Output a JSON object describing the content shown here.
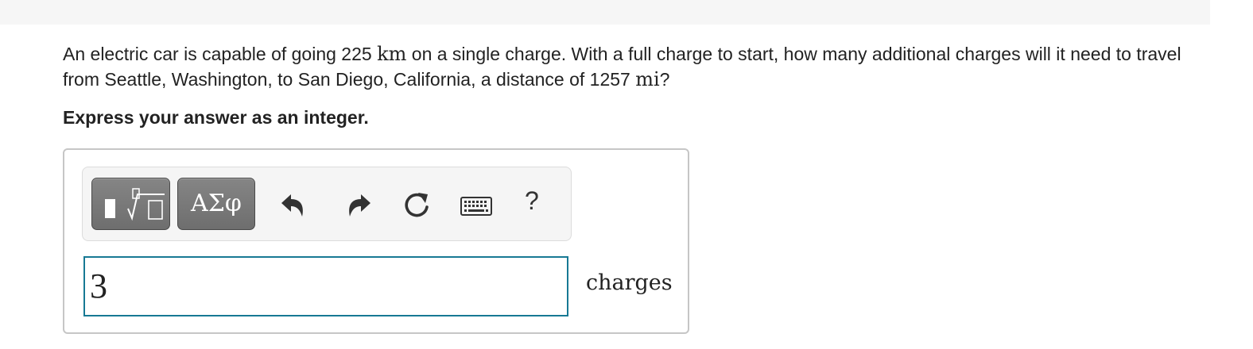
{
  "question": {
    "part1": "An electric car is capable of going 225 ",
    "unit1": "km",
    "part2": " on a single charge. With a full charge to start, how many additional charges will it need to travel from Seattle, Washington, to San Diego, California, a distance of 1257 ",
    "unit2": "mi",
    "part3": "?"
  },
  "instruction": "Express your answer as an integer.",
  "toolbar": {
    "greek_label": "ΑΣφ",
    "help_label": "?",
    "icons": [
      "templates-icon",
      "undo-icon",
      "redo-icon",
      "reset-icon",
      "keyboard-icon",
      "help-icon"
    ]
  },
  "answer": {
    "value": "3",
    "unit": "charges"
  },
  "colors": {
    "input_border": "#177994",
    "button_dark": "#777777",
    "toolbar_bg": "#f5f5f5"
  }
}
